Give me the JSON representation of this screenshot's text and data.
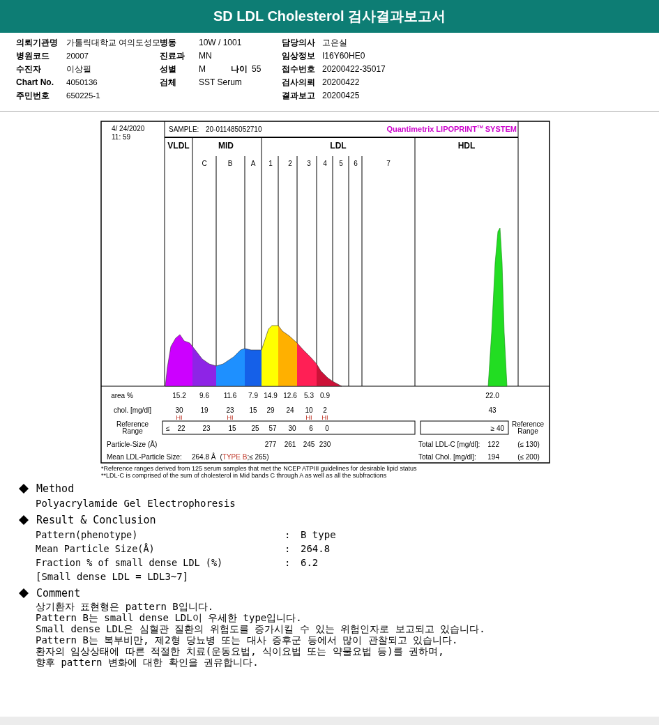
{
  "title": "SD LDL Cholesterol 검사결과보고서",
  "info_rows": [
    {
      "left": {
        "label": "의뢰기관명",
        "value": "가톨릭대학교 여의도성모"
      },
      "middle": [
        {
          "label": "병동",
          "value": "10W / 1001"
        }
      ],
      "right": {
        "label": "담당의사",
        "value": "고은실"
      }
    },
    {
      "left": {
        "label": "병원코드",
        "value": "20007"
      },
      "middle": [
        {
          "label": "진료과",
          "value": "MN"
        }
      ],
      "right": {
        "label": "임상정보",
        "value": "I16Y60HE0"
      }
    },
    {
      "left": {
        "label": "수진자",
        "value": "이상필"
      },
      "middle": [
        {
          "label": "성별",
          "value": "M"
        },
        {
          "label": "나이",
          "value": "55"
        }
      ],
      "right": {
        "label": "접수번호",
        "value": "20200422-35017"
      }
    },
    {
      "left": {
        "label": "Chart No.",
        "value": "4050136"
      },
      "middle": [
        {
          "label": "검체",
          "value": "SST Serum"
        }
      ],
      "right": {
        "label": "검사의뢰",
        "value": "20200422"
      }
    },
    {
      "left": {
        "label": "주민번호",
        "value": "650225-1"
      },
      "right": {
        "label": "결과보고",
        "value": "20200425"
      }
    }
  ],
  "lipoprint": {
    "date": "4/ 24/2020",
    "time": "11: 59",
    "sample_label": "SAMPLE:",
    "sample_id": "20-011485052710",
    "brand": "Quantimetrix LIPOPRINT",
    "brand_mark": "TM",
    "brand_suffix": " SYSTEM",
    "groups": [
      "VLDL",
      "MID",
      "LDL",
      "HDL"
    ],
    "subbands": [
      "C",
      "B",
      "A",
      "1",
      "2",
      "3",
      "4",
      "5",
      "6",
      "7"
    ],
    "area": {
      "label": "area %",
      "values": [
        "15.2",
        "9.6",
        "11.6",
        "7.9",
        "14.9",
        "12.6",
        "5.3",
        "0.9"
      ],
      "hdl": "22.0"
    },
    "chol": {
      "label": "chol. [mg/dl]",
      "values": [
        {
          "value": "30",
          "flag": "HI"
        },
        {
          "value": "19"
        },
        {
          "value": "23",
          "flag": "HI"
        },
        {
          "value": "15"
        },
        {
          "value": "29"
        },
        {
          "value": "24"
        },
        {
          "value": "10",
          "flag": "HI"
        },
        {
          "value": "2",
          "flag": "HI"
        }
      ],
      "hdl": "43"
    },
    "reference": {
      "label_lines": [
        "Reference",
        "Range"
      ],
      "prefix": "≤",
      "values": [
        "22",
        "23",
        "15",
        "25",
        "57",
        "30",
        "6",
        "0"
      ],
      "hdl": "≥ 40",
      "side_label_lines": [
        "Reference",
        "Range"
      ]
    },
    "particle_size": {
      "label": "Particle-Size (Å)",
      "values": [
        "277",
        "261",
        "245",
        "230"
      ]
    },
    "mean": {
      "label": "Mean LDL-Particle Size:",
      "value": "264.8 Å",
      "note_before": "(",
      "type": "TYPE B",
      "note_after": ";≤ 265)"
    },
    "totals": [
      {
        "label": "Total LDL-C [mg/dl]:",
        "value": "122",
        "limit": "(≤ 130)"
      },
      {
        "label": "Total Chol. [mg/dl]:",
        "value": "194",
        "limit": "(≤ 200)"
      }
    ]
  },
  "footnotes": [
    "*Reference ranges derived from 125 serum samples that met the NCEP ATPIII guidelines for desirable lipid status",
    "**LDL-C is comprised of the sum of cholesterol in Mid bands C through A as well as all the subfractions"
  ],
  "method": {
    "heading": "Method",
    "text": "Polyacrylamide Gel Electrophoresis"
  },
  "result": {
    "heading": "Result & Conclusion",
    "rows": [
      {
        "label": "Pattern(phenotype)",
        "colon": ":",
        "value": "B type"
      },
      {
        "label": "Mean Particle Size(Å)",
        "colon": ":",
        "value": "264.8"
      },
      {
        "label": "Fraction % of small dense LDL (%)",
        "colon": ":",
        "value": "6.2"
      }
    ],
    "note": "[Small dense LDL = LDL3~7]"
  },
  "comment": {
    "heading": "Comment",
    "lines": [
      "상기환자 표현형은 pattern B입니다.",
      "Pattern B는 small dense LDL이 우세한 type입니다.",
      "Small dense LDL은 심혈관 질환의 위험도를 증가시킬 수 있는 위험인자로 보고되고 있습니다.",
      "Pattern B는 복부비만, 제2형 당뇨병 또는 대사 증후군 등에서 많이 관찰되고 있습니다.",
      "환자의 임상상태에 따른 적절한 치료(운동요법, 식이요법 또는 약물요법 등)를 권하며,",
      "향후 pattern 변화에 대한 확인을 권유합니다."
    ]
  }
}
